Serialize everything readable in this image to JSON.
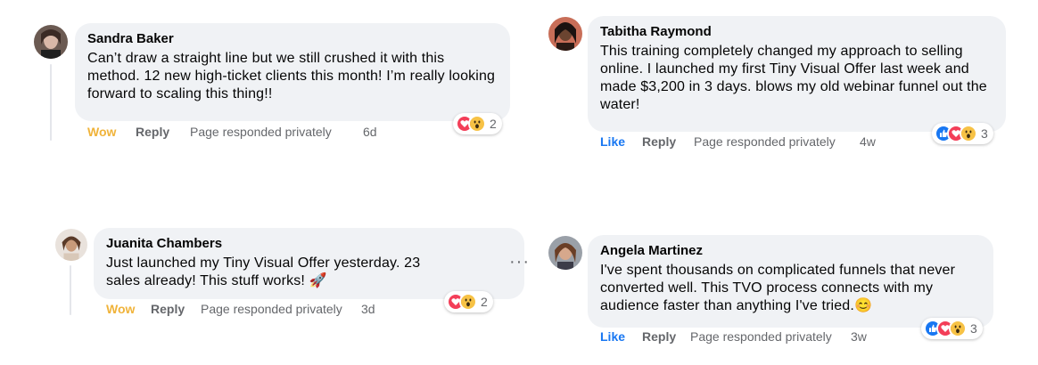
{
  "comments": [
    {
      "author": "Sandra Baker",
      "text": "Can’t draw a straight line but we still crushed it with this method. 12 new high-ticket clients this month! I’m really looking forward to scaling this thing!!",
      "react_label": "Wow",
      "reply_label": "Reply",
      "note": "Page responded privately",
      "time": "6d",
      "reaction_icons": [
        "love-icon",
        "wow-icon"
      ],
      "reaction_count": "2"
    },
    {
      "author": "Tabitha Raymond",
      "text": "This training completely changed my approach to selling online. I launched my first Tiny Visual Offer last week and made $3,200 in 3 days. blows my old webinar funnel out the water!",
      "react_label": "Like",
      "reply_label": "Reply",
      "note": "Page responded privately",
      "time": "4w",
      "reaction_icons": [
        "like-icon",
        "love-icon",
        "wow-icon"
      ],
      "reaction_count": "3"
    },
    {
      "author": "Juanita Chambers",
      "text": "Just launched my Tiny Visual Offer yesterday. 23 sales already! This stuff works! 🚀",
      "react_label": "Wow",
      "reply_label": "Reply",
      "note": "Page responded privately",
      "time": "3d",
      "reaction_icons": [
        "love-icon",
        "wow-icon"
      ],
      "reaction_count": "2"
    },
    {
      "author": "Angela Martinez",
      "text": "I've spent thousands on complicated funnels that never converted well. This TVO process connects with my audience faster than anything I've tried.😊",
      "react_label": "Like",
      "reply_label": "Reply",
      "note": "Page responded privately",
      "time": "3w",
      "reaction_icons": [
        "like-icon",
        "love-icon",
        "wow-icon"
      ],
      "reaction_count": "3"
    }
  ],
  "more_options": "···",
  "colors": {
    "bubble": "#f0f2f5",
    "wow": "#f0b33a",
    "like": "#1877f2",
    "love": "#f33e58",
    "muted": "#65676b"
  }
}
